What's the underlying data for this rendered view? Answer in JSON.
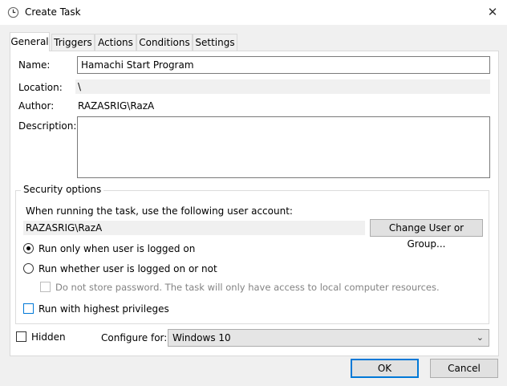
{
  "window": {
    "title": "Create Task",
    "close_glyph": "✕"
  },
  "tabs": [
    {
      "label": "General",
      "active": true
    },
    {
      "label": "Triggers"
    },
    {
      "label": "Actions"
    },
    {
      "label": "Conditions"
    },
    {
      "label": "Settings"
    }
  ],
  "general": {
    "name_label": "Name:",
    "name_value": "Hamachi Start Program",
    "location_label": "Location:",
    "location_value": "\\",
    "author_label": "Author:",
    "author_value": "RAZASRIG\\RazA",
    "description_label": "Description:",
    "description_value": ""
  },
  "security": {
    "title": "Security options",
    "account_prompt": "When running the task, use the following user account:",
    "account_value": "RAZASRIG\\RazA",
    "change_button": "Change User or Group...",
    "radio_logged_on": "Run only when user is logged on",
    "radio_whether": "Run whether user is logged on or not",
    "no_store_password": "Do not store password.  The task will only have access to local computer resources.",
    "highest_privileges": "Run with highest privileges"
  },
  "footer": {
    "hidden_label": "Hidden",
    "configure_label": "Configure for:",
    "configure_value": "Windows 10",
    "ok": "OK",
    "cancel": "Cancel"
  },
  "colors": {
    "accent": "#0078d7"
  }
}
